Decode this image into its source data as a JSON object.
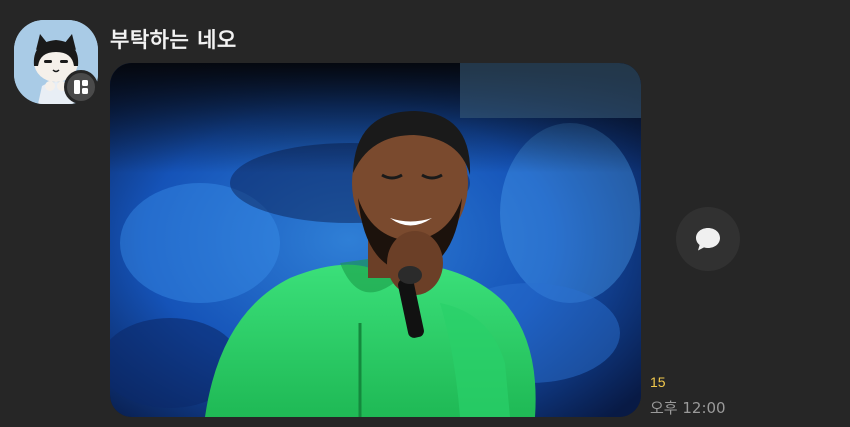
{
  "message": {
    "sender_name": "부탁하는 네오",
    "unread_count": "15",
    "timestamp": "오후 12:00"
  },
  "icons": {
    "avatar": "neo-cat-character-avatar",
    "profile_badge": "profile-card-icon",
    "share": "speech-bubble-icon"
  },
  "photo": {
    "subject": "singer-in-green-hoodie-with-microphone"
  },
  "colors": {
    "background": "#262626",
    "unread": "#f2c94c",
    "timestamp": "#9a9a9a",
    "name": "#f2f2f2"
  }
}
